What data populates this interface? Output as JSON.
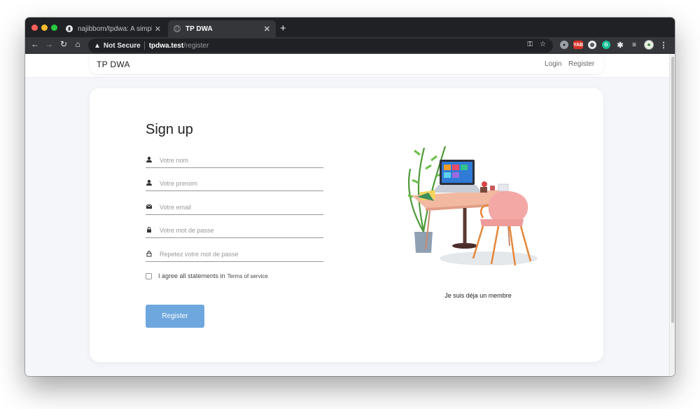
{
  "browser": {
    "tabs": [
      {
        "title": "najibbom/tpdwa: A simple logi",
        "icon": "github-icon",
        "active": false
      },
      {
        "title": "TP DWA",
        "icon": "globe-icon",
        "active": true
      }
    ],
    "security_label": "Not Secure",
    "url_host": "tpdwa.test",
    "url_path": "/register",
    "new_tab": "+",
    "extension_label": "YAB"
  },
  "nav": {
    "brand": "TP DWA",
    "links": [
      "Login",
      "Register"
    ]
  },
  "form": {
    "title": "Sign up",
    "fields": [
      {
        "placeholder": "Votre nom",
        "icon": "user-icon"
      },
      {
        "placeholder": "Votre prenom",
        "icon": "user-icon"
      },
      {
        "placeholder": "Votre email",
        "icon": "mail-icon"
      },
      {
        "placeholder": "Votre mot de passe",
        "icon": "lock-icon"
      },
      {
        "placeholder": "Repetez votre mot de passe",
        "icon": "lock-open-icon"
      }
    ],
    "agree_text": "I agree all statements in",
    "terms_link": "Terms of service",
    "submit": "Register"
  },
  "aside": {
    "member_link": "Je suis déja un membre"
  },
  "colors": {
    "button": "#6ea7de",
    "background": "#f4f6fa",
    "chrome_dark": "#202124"
  }
}
